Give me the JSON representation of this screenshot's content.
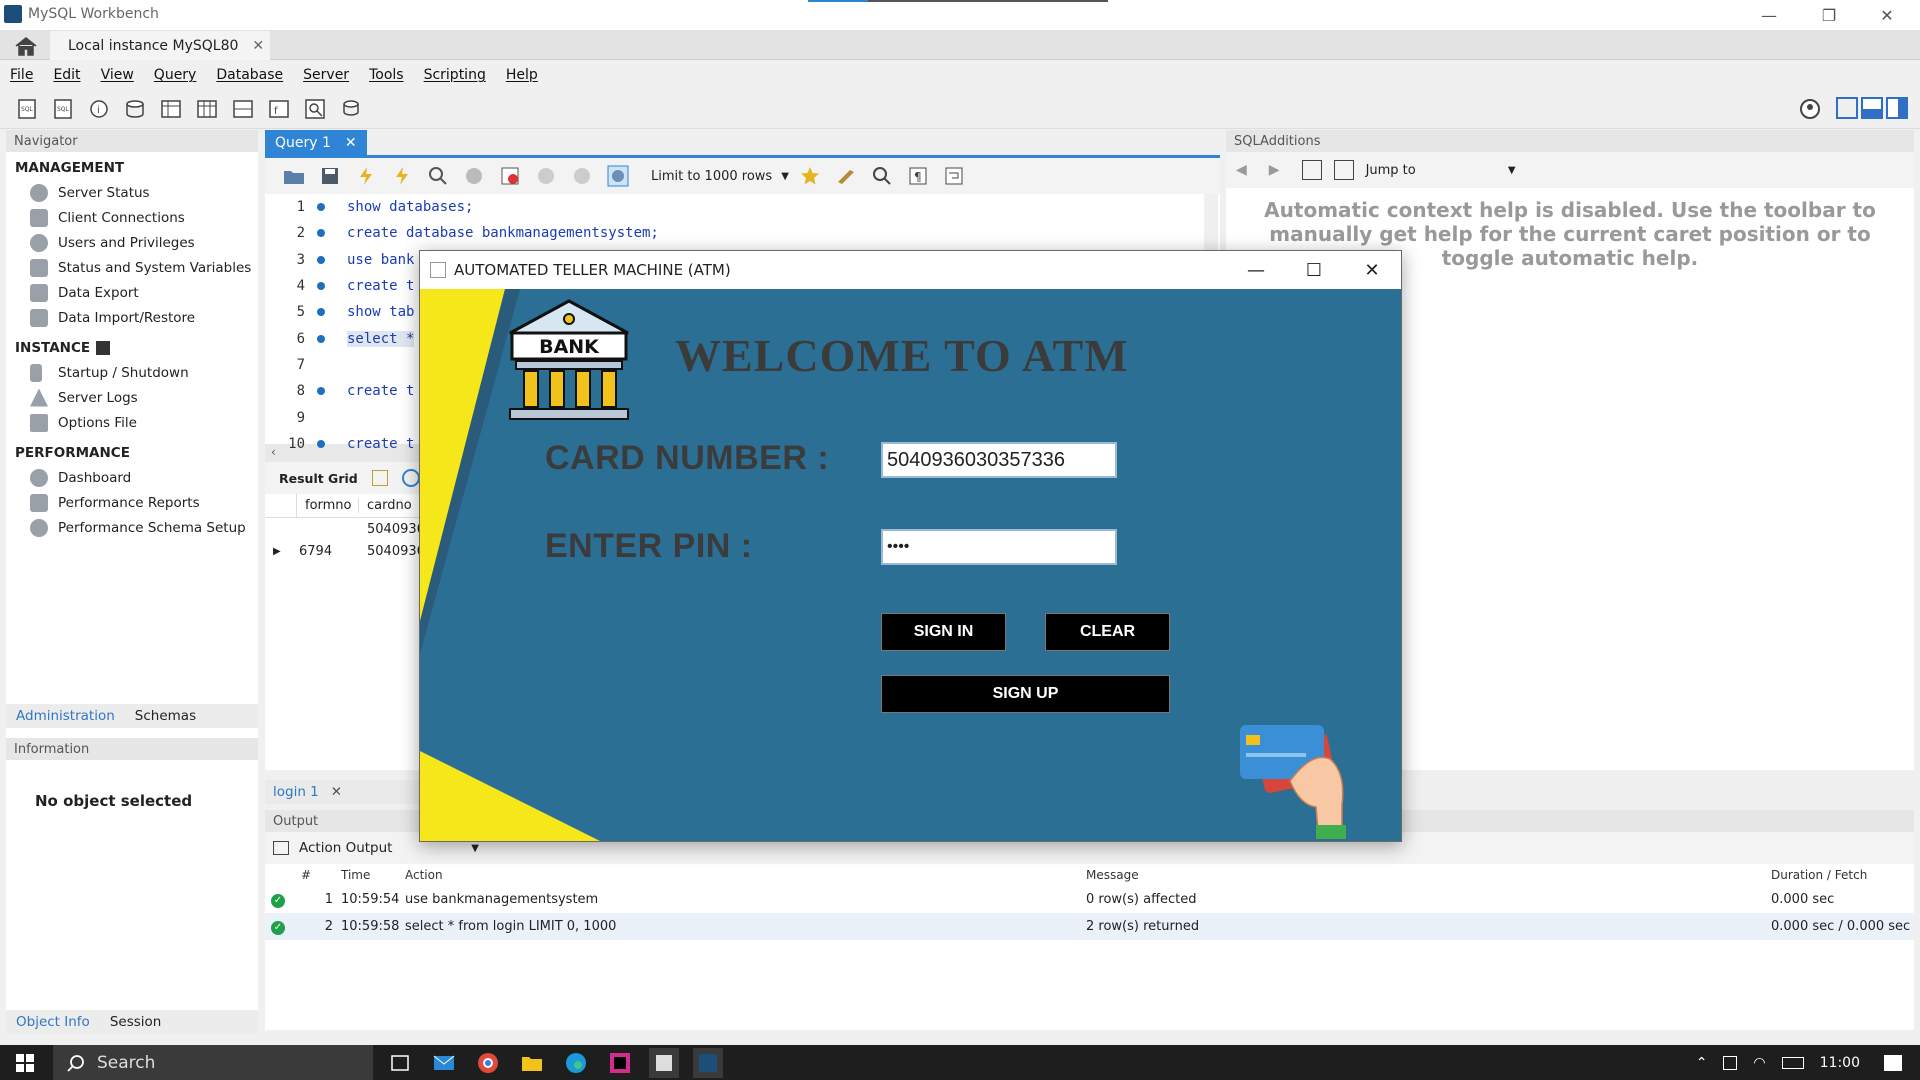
{
  "window": {
    "title": "MySQL Workbench"
  },
  "connection_tab": {
    "label": "Local instance MySQL80"
  },
  "menu": [
    "File",
    "Edit",
    "View",
    "Query",
    "Database",
    "Server",
    "Tools",
    "Scripting",
    "Help"
  ],
  "navigator": {
    "header": "Navigator",
    "management": {
      "title": "MANAGEMENT",
      "items": [
        "Server Status",
        "Client Connections",
        "Users and Privileges",
        "Status and System Variables",
        "Data Export",
        "Data Import/Restore"
      ]
    },
    "instance": {
      "title": "INSTANCE",
      "items": [
        "Startup / Shutdown",
        "Server Logs",
        "Options File"
      ]
    },
    "performance": {
      "title": "PERFORMANCE",
      "items": [
        "Dashboard",
        "Performance Reports",
        "Performance Schema Setup"
      ]
    },
    "tabs": [
      "Administration",
      "Schemas"
    ],
    "info_header": "Information",
    "info_text": "No object selected",
    "bottom_tabs": [
      "Object Info",
      "Session"
    ]
  },
  "editor": {
    "tab": "Query 1",
    "limit": "Limit to 1000 rows",
    "lines": [
      {
        "n": "1",
        "code": "show databases;"
      },
      {
        "n": "2",
        "code": "create database bankmanagementsystem;"
      },
      {
        "n": "3",
        "code": "use bank"
      },
      {
        "n": "4",
        "code": "create t"
      },
      {
        "n": "5",
        "code": "show tab"
      },
      {
        "n": "6",
        "code": "select *"
      },
      {
        "n": "7",
        "code": ""
      },
      {
        "n": "8",
        "code": "create t"
      },
      {
        "n": "9",
        "code": ""
      },
      {
        "n": "10",
        "code": "create t"
      }
    ],
    "result_grid_label": "Result Grid",
    "columns": [
      "formno",
      "cardno"
    ],
    "rows": [
      [
        "",
        "50409360"
      ],
      [
        "6794",
        "50409360"
      ]
    ],
    "result_tab": "login 1"
  },
  "sqladditions": {
    "header": "SQLAdditions",
    "jump_to": "Jump to",
    "help": "Automatic context help is disabled. Use the toolbar to manually get help for the current caret position or to toggle automatic help."
  },
  "output": {
    "header": "Output",
    "selector": "Action Output",
    "columns": [
      "#",
      "Time",
      "Action",
      "Message",
      "Duration / Fetch"
    ],
    "rows": [
      {
        "n": "1",
        "time": "10:59:54",
        "action": "use bankmanagementsystem",
        "message": "0 row(s) affected",
        "duration": "0.000 sec"
      },
      {
        "n": "2",
        "time": "10:59:58",
        "action": "select * from login LIMIT 0, 1000",
        "message": "2 row(s) returned",
        "duration": "0.000 sec / 0.000 sec"
      }
    ]
  },
  "atm": {
    "title": "AUTOMATED TELLER MACHINE (ATM)",
    "logo_text": "BANK",
    "welcome": "WELCOME TO ATM",
    "card_label": "CARD NUMBER :",
    "card_value": "5040936030357336",
    "pin_label": "ENTER PIN :",
    "pin_value": "••••",
    "signin": "SIGN IN",
    "clear": "CLEAR",
    "signup": "SIGN UP",
    "colors": {
      "bg": "#2c6f95",
      "accent": "#f5e71a"
    }
  },
  "taskbar": {
    "search": "Search",
    "time": "11:00"
  }
}
